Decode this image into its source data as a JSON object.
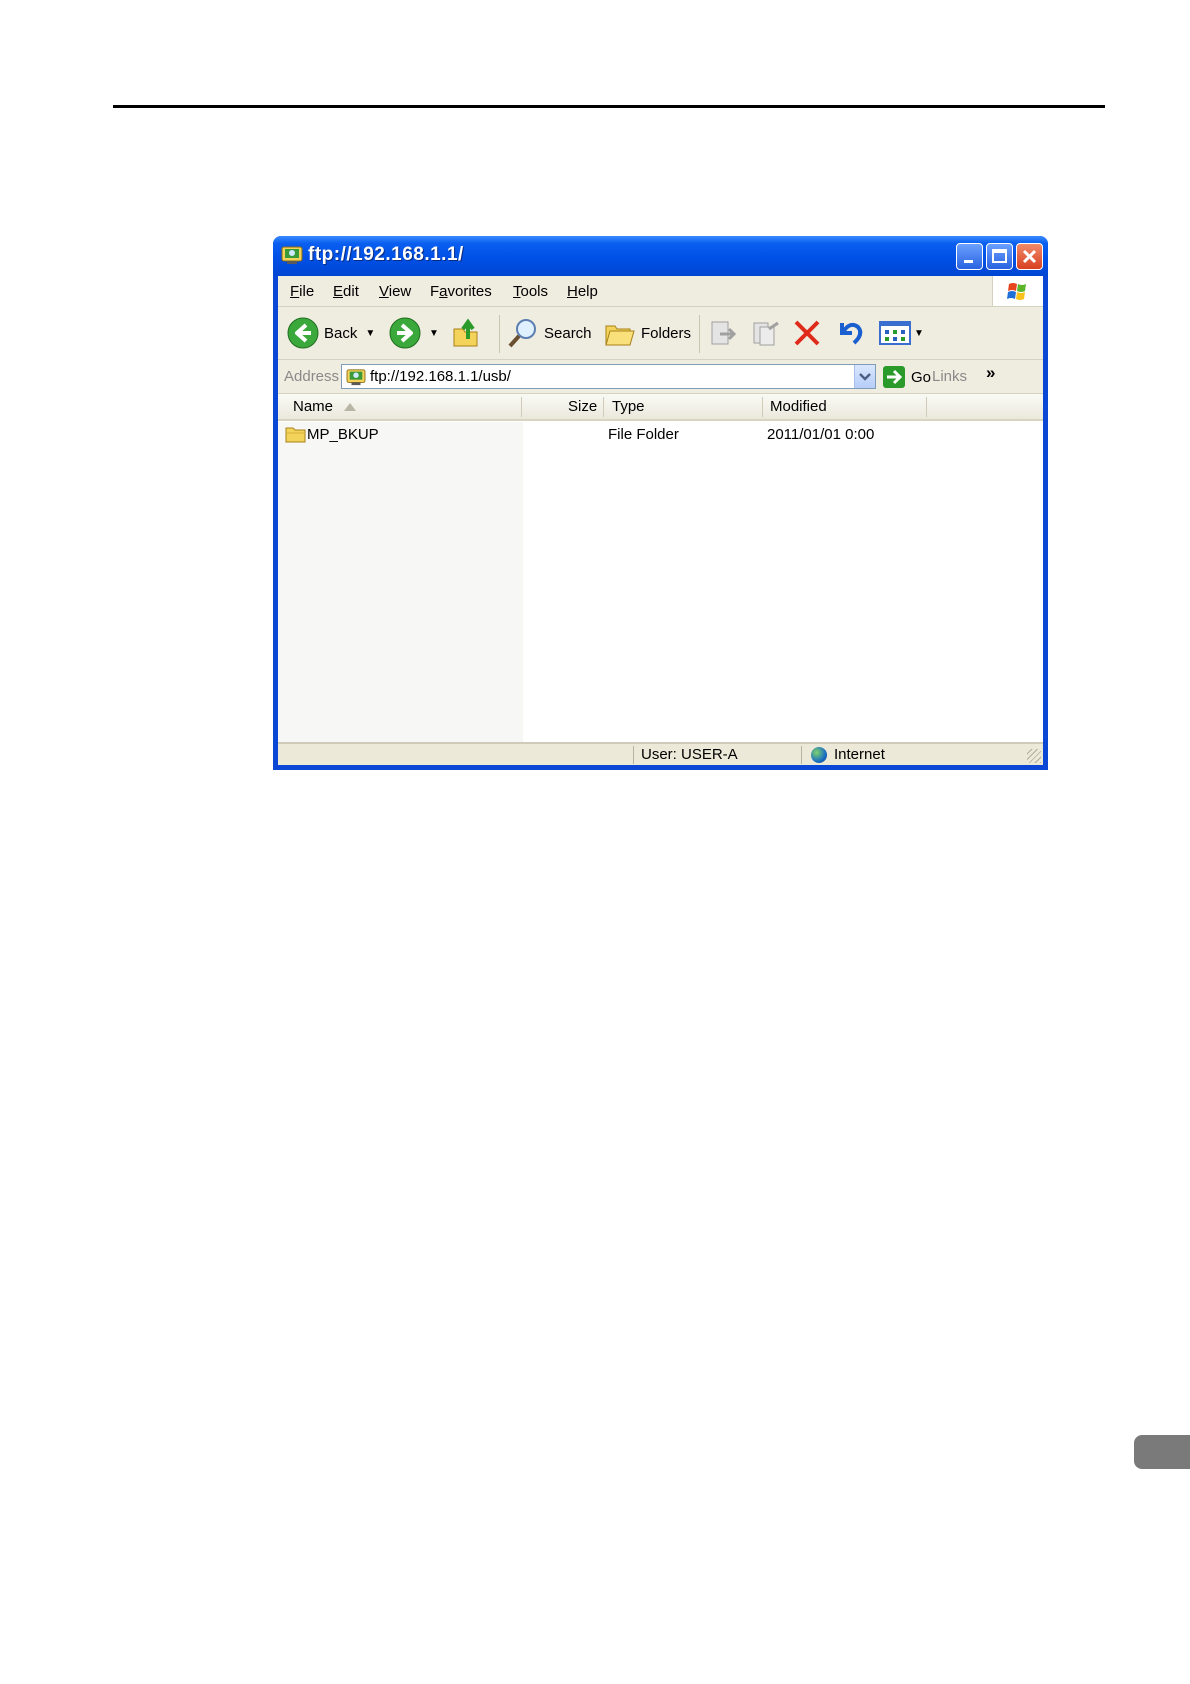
{
  "window": {
    "title": "ftp://192.168.1.1/",
    "title_icon": "ftp-folder-icon"
  },
  "menu": {
    "items": [
      {
        "label": "File",
        "accel_index": 0
      },
      {
        "label": "Edit",
        "accel_index": 0
      },
      {
        "label": "View",
        "accel_index": 0
      },
      {
        "label": "Favorites",
        "accel_index": 1
      },
      {
        "label": "Tools",
        "accel_index": 0
      },
      {
        "label": "Help",
        "accel_index": 0
      }
    ]
  },
  "toolbar": {
    "back_label": "Back",
    "search_label": "Search",
    "folders_label": "Folders"
  },
  "address": {
    "label": "Address",
    "value": "ftp://192.168.1.1/usb/",
    "go_label": "Go",
    "links_label": "Links",
    "more": "»"
  },
  "list": {
    "columns": [
      "Name",
      "Size",
      "Type",
      "Modified"
    ],
    "rows": [
      {
        "name": "MP_BKUP",
        "size": "",
        "type": "File Folder",
        "modified": "2011/01/01 0:00"
      }
    ]
  },
  "status": {
    "user": "User: USER-A",
    "zone": "Internet"
  },
  "colors": {
    "titlebar": "#0050e6",
    "frame": "#0a47d4",
    "chrome": "#ece9d8",
    "delete_red": "#e02a1a",
    "undo_blue": "#1a5fd0",
    "go_green": "#2a9a2a"
  }
}
